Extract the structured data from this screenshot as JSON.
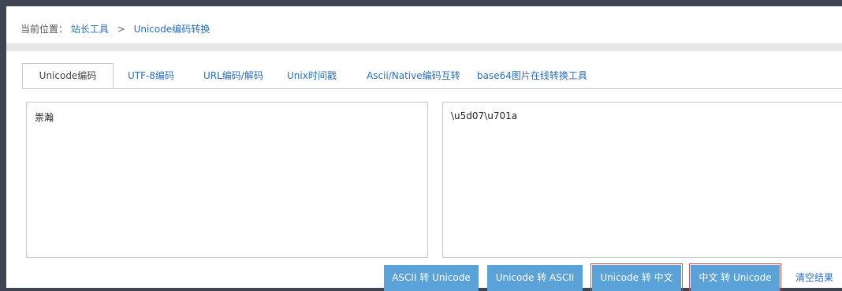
{
  "breadcrumb": {
    "prefix": "当前位置：",
    "tools_link": "站长工具",
    "separator": ">",
    "current": "Unicode编码转换"
  },
  "tabs": [
    {
      "label": "Unicode编码",
      "active": true
    },
    {
      "label": "UTF-8编码",
      "active": false
    },
    {
      "label": "URL编码/解码",
      "active": false
    },
    {
      "label": "Unix时间戳",
      "active": false
    },
    {
      "label": "Ascii/Native编码互转",
      "active": false
    },
    {
      "label": "base64图片在线转换工具",
      "active": false
    }
  ],
  "input": {
    "value": "祟瀚"
  },
  "output": {
    "value": "\\u5d07\\u701a"
  },
  "buttons": {
    "ascii_to_unicode": "ASCII 转 Unicode",
    "unicode_to_ascii": "Unicode 转 ASCII",
    "unicode_to_chinese": "Unicode 转 中文",
    "chinese_to_unicode": "中文 转 Unicode",
    "clear": "清空结果"
  },
  "colors": {
    "button_blue": "#5aa2d8",
    "link_blue": "#2a6ebb",
    "highlight_red": "#d94a4a",
    "frame_dark": "#3e4452"
  }
}
